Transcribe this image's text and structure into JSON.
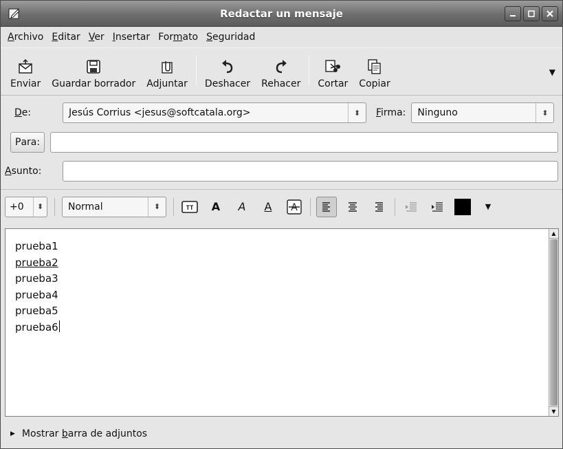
{
  "window": {
    "title": "Redactar un mensaje"
  },
  "menu": [
    {
      "pre": "",
      "ul": "A",
      "post": "rchivo"
    },
    {
      "pre": "",
      "ul": "E",
      "post": "ditar"
    },
    {
      "pre": "",
      "ul": "V",
      "post": "er"
    },
    {
      "pre": "",
      "ul": "I",
      "post": "nsertar"
    },
    {
      "pre": "For",
      "ul": "m",
      "post": "ato"
    },
    {
      "pre": "",
      "ul": "S",
      "post": "eguridad"
    }
  ],
  "toolbar": {
    "send": "Enviar",
    "save_draft": "Guardar borrador",
    "attach": "Adjuntar",
    "undo": "Deshacer",
    "redo": "Rehacer",
    "cut": "Cortar",
    "copy": "Copiar"
  },
  "header": {
    "from_label_ul": "D",
    "from_label_rest": "e:",
    "from_value": "Jesús Corrius <jesus@softcatala.org>",
    "signature_label_ul": "F",
    "signature_label_rest": "irma:",
    "signature_value": "Ninguno",
    "to_label_ul": "P",
    "to_label_rest": "ara:",
    "to_value": "",
    "subject_label_ul": "A",
    "subject_label_rest": "sunto:",
    "subject_value": ""
  },
  "format": {
    "size_value": "+0",
    "style_value": "Normal",
    "text_color": "#000000"
  },
  "editor": {
    "lines": [
      "prueba1",
      "prueba2",
      "prueba3",
      "prueba4",
      "prueba5",
      "prueba6"
    ]
  },
  "attachments": {
    "pre": "Mostrar ",
    "ul": "b",
    "post": "arra de adjuntos"
  }
}
